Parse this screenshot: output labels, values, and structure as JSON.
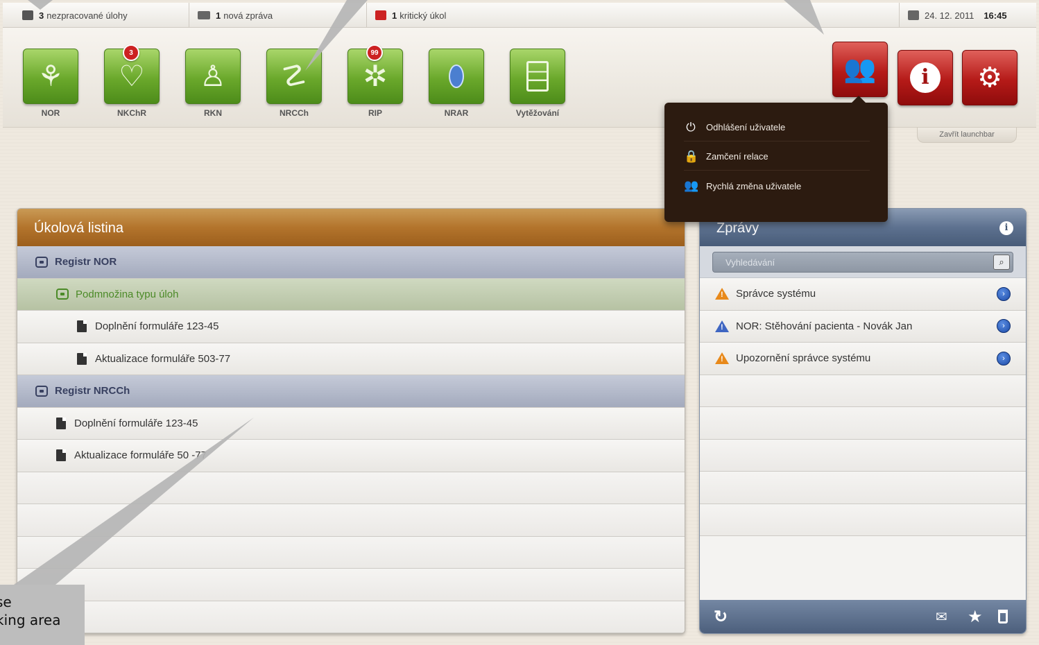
{
  "topbar": {
    "tasks_count": "3",
    "tasks_text": "nezpracované úlohy",
    "messages_count": "1",
    "messages_text": "nová zpráva",
    "critical_count": "1",
    "critical_text": "kritický úkol",
    "date": "24. 12. 2011",
    "time": "16:45"
  },
  "apps": [
    {
      "label": "NOR",
      "icon": "plant-icon",
      "badge": ""
    },
    {
      "label": "NKChR",
      "icon": "heart-icon",
      "badge": "3"
    },
    {
      "label": "RKN",
      "icon": "bone-joint-icon",
      "badge": ""
    },
    {
      "label": "NRCCh",
      "icon": "vessel-icon",
      "badge": ""
    },
    {
      "label": "RIP",
      "icon": "star-of-life-icon",
      "badge": "99"
    },
    {
      "label": "NRAR",
      "icon": "embryo-icon",
      "badge": ""
    },
    {
      "label": "Vytěžování",
      "icon": "cabinet-icon",
      "badge": ""
    }
  ],
  "system_buttons": [
    {
      "icon": "users-icon"
    },
    {
      "icon": "info-icon"
    },
    {
      "icon": "settings-icon"
    }
  ],
  "close_launchbar": "Zavřít launchbar",
  "user_menu": {
    "items": [
      {
        "label": "Odhlášení uživatele",
        "icon": "power-icon"
      },
      {
        "label": "Zamčení relace",
        "icon": "lock-icon"
      },
      {
        "label": "Rychlá změna uživatele",
        "icon": "switch-user-icon"
      }
    ]
  },
  "tasks_panel": {
    "title": "Úkolová listina",
    "rows": [
      {
        "type": "registry",
        "label": "Registr NOR"
      },
      {
        "type": "subset",
        "label": "Podmnožina typu úloh"
      },
      {
        "type": "task",
        "label": "Doplnění formuláře 123-45"
      },
      {
        "type": "task",
        "label": "Aktualizace formuláře 503-77"
      },
      {
        "type": "registry",
        "label": "Registr NRCCh"
      },
      {
        "type": "task",
        "label": "Doplnění formuláře 123-45"
      },
      {
        "type": "task",
        "label": "Aktualizace formuláře 50  -77"
      }
    ]
  },
  "news_panel": {
    "title": "Zprávy",
    "search_placeholder": "Vyhledávání",
    "messages": [
      {
        "label": "Správce systému",
        "color": "#e8891a"
      },
      {
        "label": "NOR: Stěhování pacienta - Novák Jan",
        "color": "#3f66c2"
      },
      {
        "label": "Upozornění správce systému",
        "color": "#e8891a"
      }
    ]
  },
  "callout": {
    "line1": "se",
    "line2": "king area"
  },
  "colors": {
    "tasks_header": "#b3742c",
    "news_header": "#5d718f",
    "app_tile": "#6aa82b",
    "system_tile": "#b51a18",
    "menu_bg": "#2c1b10"
  }
}
